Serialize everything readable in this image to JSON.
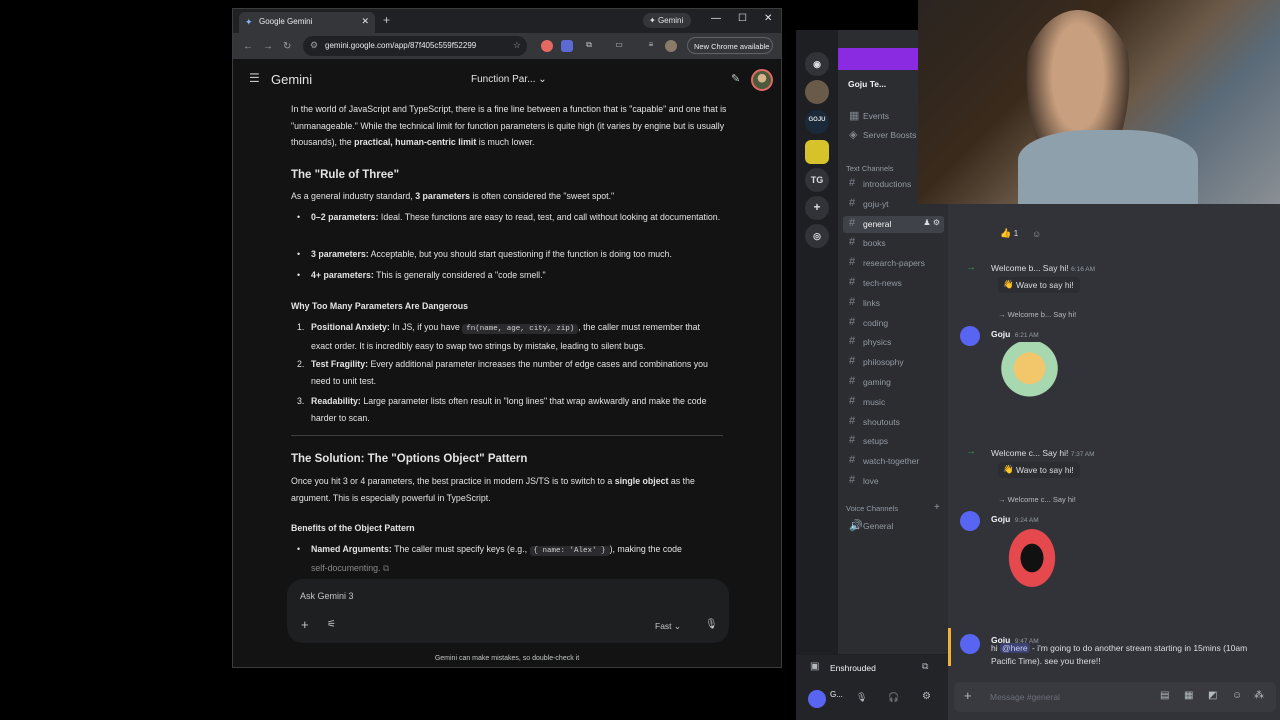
{
  "chrome": {
    "tab_title": "Google Gemini",
    "gemini_button": "Gemini",
    "url": "gemini.google.com/app/87f405c559f52299",
    "new_chrome": "New Chrome available"
  },
  "gemini": {
    "app_title": "Gemini",
    "chat_title": "Function Par...",
    "intro_1": "In the world of JavaScript and TypeScript, there is a fine line between a function that is \"capable\" and one that is \"unmanageable.\" While the technical limit for function parameters is quite high (it varies by engine but is usually thousands), the ",
    "intro_bold": "practical, human-centric limit",
    "intro_2": " is much lower.",
    "h_rule_of_three": "The \"Rule of Three\"",
    "rot_text_1": "As a general industry standard, ",
    "rot_bold": "3 parameters",
    "rot_text_2": " is often considered the \"sweet spot.\"",
    "bullets": [
      {
        "bold": "0–2 parameters:",
        "text": " Ideal. These functions are easy to read, test, and call without looking at documentation."
      },
      {
        "bold": "3 parameters:",
        "text": " Acceptable, but you should start questioning if the function is doing too much."
      },
      {
        "bold": "4+ parameters:",
        "text": " This is generally considered a \"code smell.\""
      }
    ],
    "h_why": "Why Too Many Parameters Are Dangerous",
    "why_items": [
      {
        "num": "1.",
        "bold": "Positional Anxiety:",
        "pre": " In JS, if you have ",
        "code": "fn(name, age, city, zip)",
        "text": ", the caller must remember that exact order. It is incredibly easy to swap two strings by mistake, leading to silent bugs."
      },
      {
        "num": "2.",
        "bold": "Test Fragility:",
        "text": " Every additional parameter increases the number of edge cases and combinations you need to unit test."
      },
      {
        "num": "3.",
        "bold": "Readability:",
        "text": " Large parameter lists often result in \"long lines\" that wrap awkwardly and make the code harder to scan."
      }
    ],
    "h_solution": "The Solution: The \"Options Object\" Pattern",
    "sol_text_1": "Once you hit 3 or 4 parameters, the best practice in modern JS/TS is to switch to a ",
    "sol_bold": "single object",
    "sol_text_2": " as the argument. This is especially powerful in TypeScript.",
    "h_benefits": "Benefits of the Object Pattern",
    "benefit_bold": "Named Arguments:",
    "benefit_pre": " The caller must specify keys (e.g., ",
    "benefit_code": "{ name: 'Alex' }",
    "benefit_post": "), making the code",
    "benefit_tail": "self-documenting.",
    "ask_placeholder": "Ask Gemini 3",
    "mode": "Fast",
    "disclaimer": "Gemini can make mistakes, so double-check it"
  },
  "discord": {
    "server_name": "Goju Te...",
    "events": "Events",
    "server_boosts": "Server Boosts",
    "text_category": "Text Channels",
    "channels": [
      "introductions",
      "goju-yt",
      "general",
      "books",
      "research-papers",
      "tech-news",
      "links",
      "coding",
      "physics",
      "philosophy",
      "gaming",
      "music",
      "shoutouts",
      "setups",
      "watch-together",
      "love"
    ],
    "active_channel": "general",
    "voice_category": "Voice Channels",
    "voice_channel": "General",
    "guild_tg": "TG",
    "reaction_count": "1",
    "welcome_1": "Welcome b... Say hi!",
    "welcome_1_time": "6:16 AM",
    "wave_label": "Wave to say hi!",
    "reply_1": "Welcome b... Say hi!",
    "goju": "Goju",
    "time_1": "6:21 AM",
    "welcome_2": "Welcome c... Say hi!",
    "welcome_2_time": "7:37 AM",
    "reply_2": "Welcome c... Say hi!",
    "time_2": "9:24 AM",
    "time_3": "9:47 AM",
    "mention": "@here",
    "msg_pre": "hi ",
    "msg_post": " - i'm going to do another stream starting in 15mins (10am Pacific Time). see you there!!",
    "activity": "Enshrouded",
    "input_placeholder": "Message #general",
    "user_short": "G..."
  },
  "colors": {
    "gemini_bg": "#131314",
    "discord_bg": "#313338",
    "discord_accent": "#5865f2",
    "banner": "#8a2be2"
  }
}
